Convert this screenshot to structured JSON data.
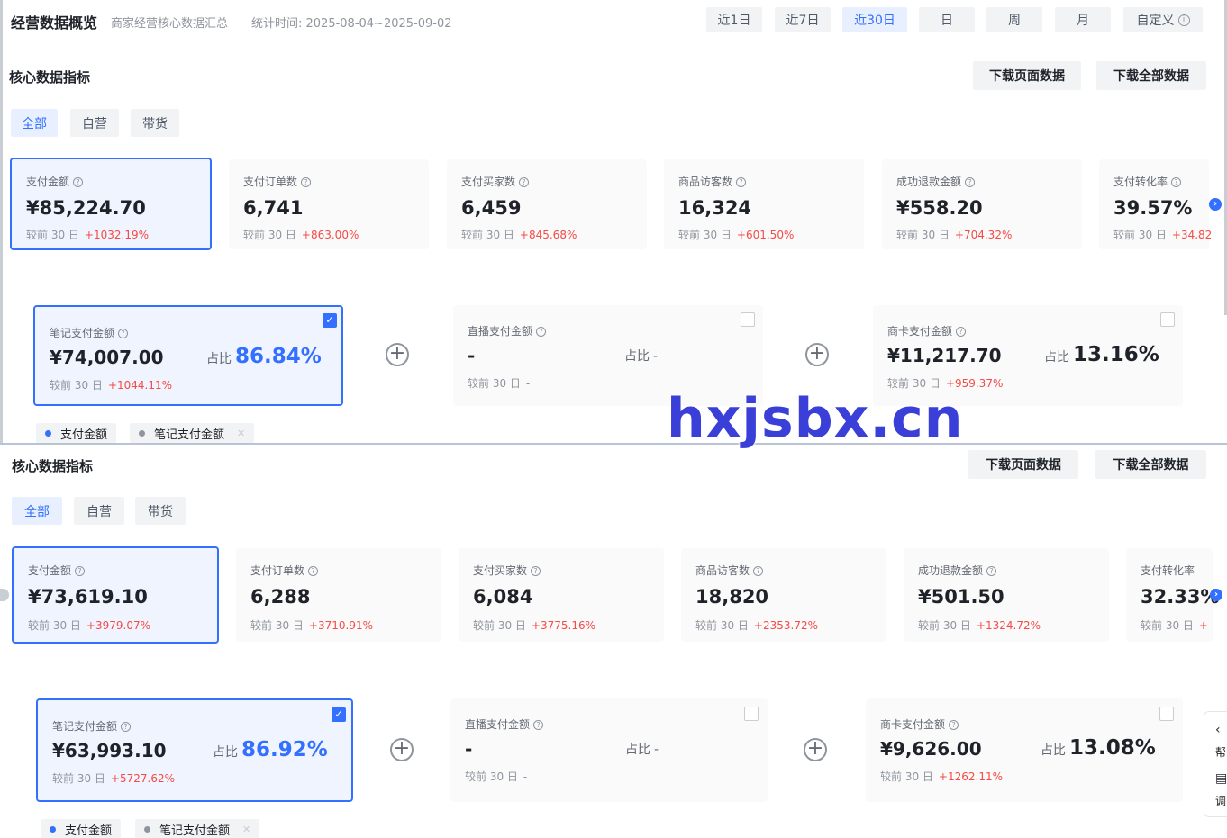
{
  "header": {
    "title": "经营数据概览",
    "subtitle": "商家经营核心数据汇总",
    "time_label": "统计时间: 2025-08-04~2025-09-02",
    "time_tabs": [
      "近1日",
      "近7日",
      "近30日",
      "日",
      "周",
      "月",
      "自定义"
    ],
    "active_time_tab": "近30日"
  },
  "top": {
    "section_title": "核心数据指标",
    "download_page": "下载页面数据",
    "download_all": "下载全部数据",
    "filters": [
      "全部",
      "自营",
      "带货"
    ],
    "metrics": [
      {
        "label": "支付金额",
        "value": "¥85,224.70",
        "cmp": "较前 30 日",
        "change": "+1032.19%"
      },
      {
        "label": "支付订单数",
        "value": "6,741",
        "cmp": "较前 30 日",
        "change": "+863.00%"
      },
      {
        "label": "支付买家数",
        "value": "6,459",
        "cmp": "较前 30 日",
        "change": "+845.68%"
      },
      {
        "label": "商品访客数",
        "value": "16,324",
        "cmp": "较前 30 日",
        "change": "+601.50%"
      },
      {
        "label": "成功退款金额",
        "value": "¥558.20",
        "cmp": "较前 30 日",
        "change": "+704.32%"
      },
      {
        "label": "支付转化率",
        "value": "39.57%",
        "cmp": "较前 30 日",
        "change": "+34.82"
      }
    ],
    "breakdown": [
      {
        "label": "笔记支付金额",
        "value": "¥74,007.00",
        "share_label": "占比",
        "share": "86.84%",
        "cmp": "较前 30 日",
        "change": "+1044.11%"
      },
      {
        "label": "直播支付金额",
        "value": "-",
        "share_label": "占比",
        "share": "-",
        "cmp": "较前 30 日",
        "change": "-"
      },
      {
        "label": "商卡支付金额",
        "value": "¥11,217.70",
        "share_label": "占比",
        "share": "13.16%",
        "cmp": "较前 30 日",
        "change": "+959.37%"
      }
    ],
    "legend": [
      "支付金额",
      "笔记支付金额"
    ]
  },
  "bottom": {
    "section_title": "核心数据指标",
    "download_page": "下载页面数据",
    "download_all": "下载全部数据",
    "filters": [
      "全部",
      "自营",
      "带货"
    ],
    "metrics": [
      {
        "label": "支付金额",
        "value": "¥73,619.10",
        "cmp": "较前 30 日",
        "change": "+3979.07%"
      },
      {
        "label": "支付订单数",
        "value": "6,288",
        "cmp": "较前 30 日",
        "change": "+3710.91%"
      },
      {
        "label": "支付买家数",
        "value": "6,084",
        "cmp": "较前 30 日",
        "change": "+3775.16%"
      },
      {
        "label": "商品访客数",
        "value": "18,820",
        "cmp": "较前 30 日",
        "change": "+2353.72%"
      },
      {
        "label": "成功退款金额",
        "value": "¥501.50",
        "cmp": "较前 30 日",
        "change": "+1324.72%"
      },
      {
        "label": "支付转化率",
        "value": "32.33%",
        "cmp": "较前 30 日",
        "change": "+"
      }
    ],
    "breakdown": [
      {
        "label": "笔记支付金额",
        "value": "¥63,993.10",
        "share_label": "占比",
        "share": "86.92%",
        "cmp": "较前 30 日",
        "change": "+5727.62%"
      },
      {
        "label": "直播支付金额",
        "value": "-",
        "share_label": "占比",
        "share": "-",
        "cmp": "较前 30 日",
        "change": "-"
      },
      {
        "label": "商卡支付金额",
        "value": "¥9,626.00",
        "share_label": "占比",
        "share": "13.08%",
        "cmp": "较前 30 日",
        "change": "+1262.11%"
      }
    ],
    "legend": [
      "支付金额",
      "笔记支付金额"
    ]
  },
  "watermark": "hxjsbx.cn",
  "side_float": [
    "帮",
    "调"
  ],
  "colors": {
    "accent": "#3370ff",
    "increase": "#f54a45",
    "card_bg": "#fafafa",
    "watermark": "#3a3fd8"
  }
}
